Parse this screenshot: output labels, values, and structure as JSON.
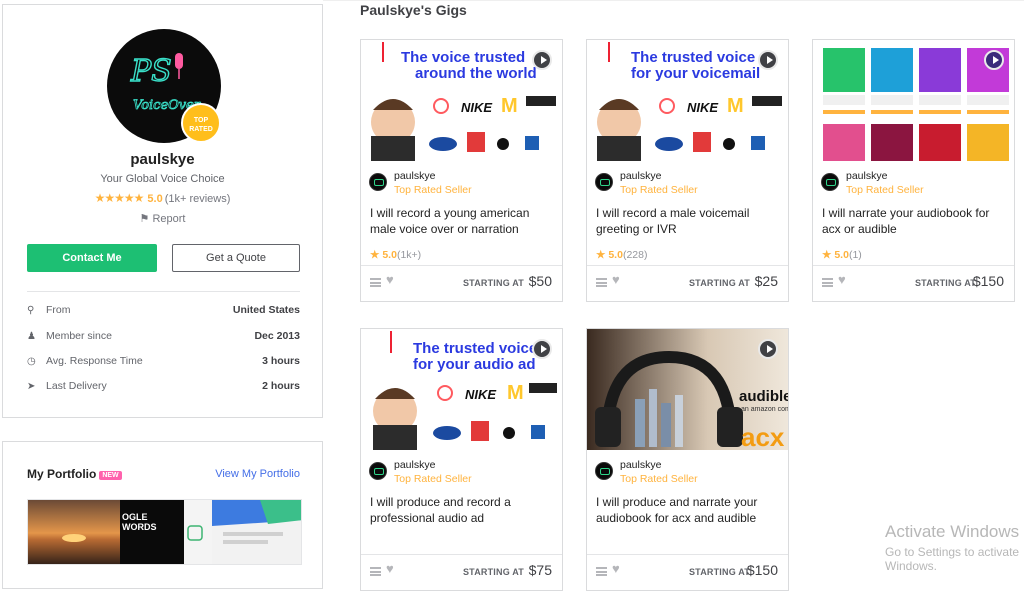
{
  "profile": {
    "avatar_text_1": "PS",
    "avatar_text_2": "VoiceOver",
    "badge": "TOP RATED",
    "username": "paulskye",
    "tagline": "Your Global Voice Choice",
    "stars": "★★★★★",
    "rating": "5.0",
    "reviews": "(1k+ reviews)",
    "report": "Report",
    "contact_label": "Contact Me",
    "quote_label": "Get a Quote",
    "stats": [
      {
        "icon": "location-pin-icon",
        "label": "From",
        "value": "United States"
      },
      {
        "icon": "user-icon",
        "label": "Member since",
        "value": "Dec 2013"
      },
      {
        "icon": "clock-icon",
        "label": "Avg. Response Time",
        "value": "3 hours"
      },
      {
        "icon": "send-icon",
        "label": "Last Delivery",
        "value": "2 hours"
      }
    ]
  },
  "portfolio": {
    "title": "My Portfolio",
    "badge": "NEW",
    "link": "View My Portfolio",
    "strip_text": "OGLE\nWORDS"
  },
  "gigs": {
    "heading": "Paulskye's Gigs",
    "starting_label": "STARTING AT",
    "items": [
      {
        "thumb_line1": "The voice trusted",
        "thumb_line2": "around the world",
        "seller": "paulskye",
        "level": "Top Rated Seller",
        "title": "I will record a young american male voice over or narration",
        "rating": "5.0",
        "count": "(1k+)",
        "price": "$50"
      },
      {
        "thumb_line1": "The trusted voice",
        "thumb_line2": "for your voicemail",
        "seller": "paulskye",
        "level": "Top Rated Seller",
        "title": "I will record a male voicemail greeting or IVR",
        "rating": "5.0",
        "count": "(228)",
        "price": "$25"
      },
      {
        "thumb_line1": "",
        "thumb_line2": "",
        "seller": "paulskye",
        "level": "Top Rated Seller",
        "title": "I will narrate your audiobook for acx or audible",
        "rating": "5.0",
        "count": "(1)",
        "price": "$150"
      },
      {
        "thumb_line1": "The trusted voice",
        "thumb_line2": "for your audio ad",
        "seller": "paulskye",
        "level": "Top Rated Seller",
        "title": "I will produce and record a professional audio ad",
        "rating": "",
        "count": "",
        "price": "$75"
      },
      {
        "thumb_line1": "audible",
        "thumb_line2": "acx",
        "seller": "paulskye",
        "level": "Top Rated Seller",
        "title": "I will produce and narrate your audiobook for acx and audible",
        "rating": "",
        "count": "",
        "price": "$150"
      }
    ]
  },
  "watermark": {
    "line1": "Activate Windows",
    "line2": "Go to Settings to activate Windows."
  },
  "colors": {
    "accent": "#1dbf73",
    "star": "#ffb33e",
    "link": "#446ee7",
    "new_badge": "#ff62ad"
  }
}
